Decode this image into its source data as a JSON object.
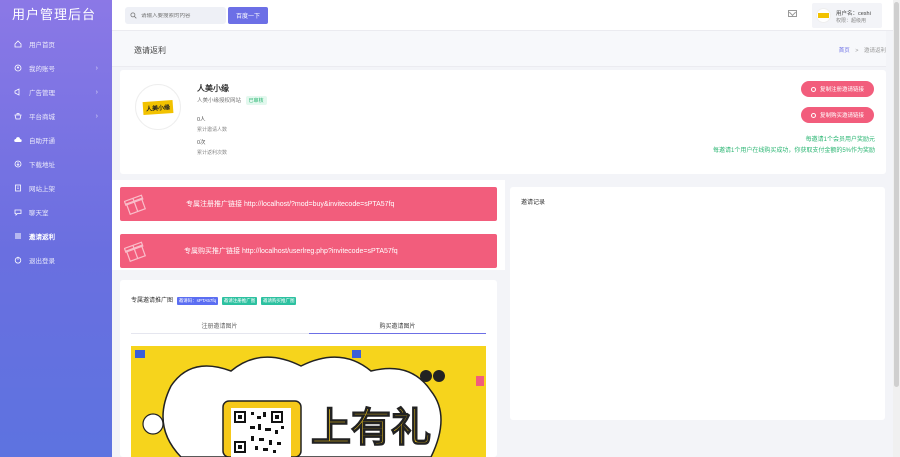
{
  "app": {
    "title": "用户管理后台"
  },
  "sidebar": {
    "items": [
      {
        "label": "用户首页",
        "icon": "home-icon",
        "arrow": false
      },
      {
        "label": "我的账号",
        "icon": "user-circle-icon",
        "arrow": true
      },
      {
        "label": "广告管理",
        "icon": "megaphone-icon",
        "arrow": true
      },
      {
        "label": "平台商城",
        "icon": "shop-icon",
        "arrow": true
      },
      {
        "label": "自助开通",
        "icon": "cloud-icon",
        "arrow": false
      },
      {
        "label": "下载地址",
        "icon": "download-icon",
        "arrow": false
      },
      {
        "label": "网站上架",
        "icon": "upload-icon",
        "arrow": false
      },
      {
        "label": "聊天室",
        "icon": "chat-icon",
        "arrow": false
      },
      {
        "label": "邀请返利",
        "icon": "invite-icon",
        "arrow": false,
        "active": true
      },
      {
        "label": "退出登录",
        "icon": "logout-icon",
        "arrow": false
      }
    ]
  },
  "topbar": {
    "search_placeholder": "请输入要搜索的内容",
    "search_button": "百度一下",
    "user_name": "用户名：ceshi",
    "user_role": "权限：超级用"
  },
  "page": {
    "title": "邀请返利",
    "breadcrumb_home": "首页",
    "breadcrumb_sep": ">",
    "breadcrumb_current": "邀请返利"
  },
  "profile": {
    "logo_text": "人美小缘",
    "name": "人美小缘",
    "desc": "人美小缘授权网站",
    "status": "已审核",
    "invite_count": "0人",
    "invite_count_label": "累计邀请人数",
    "rebate_count": "0次",
    "rebate_count_label": "累计返利次数",
    "btn_copy_register": "复制注册邀请链接",
    "btn_copy_buy": "复制购买邀请链接",
    "note1": "每邀请1个会员用户奖励元",
    "note2": "每邀请1个用户在线购买成功，你获取支付金额的5%作为奖励"
  },
  "banners": [
    {
      "text": "专属注册推广链接 http://localhost/?mod=buy&invitecode=sPTA57fq"
    },
    {
      "text": "专属购买推广链接 http://localhost/userlreg.php?invitecode=sPTA57fq"
    }
  ],
  "right_panel": {
    "title": "邀请记录"
  },
  "poster": {
    "title": "专属邀请推广图",
    "tags": [
      "邀请码：sPTA57fq",
      "邀请注册推广图",
      "邀请购买推广图"
    ],
    "tabs": [
      "注册邀请图片",
      "购买邀请图片"
    ],
    "poster_text": "上有礼"
  },
  "colors": {
    "accent": "#6c6fe6",
    "pink": "#f25d7c",
    "green": "#2bb673"
  }
}
